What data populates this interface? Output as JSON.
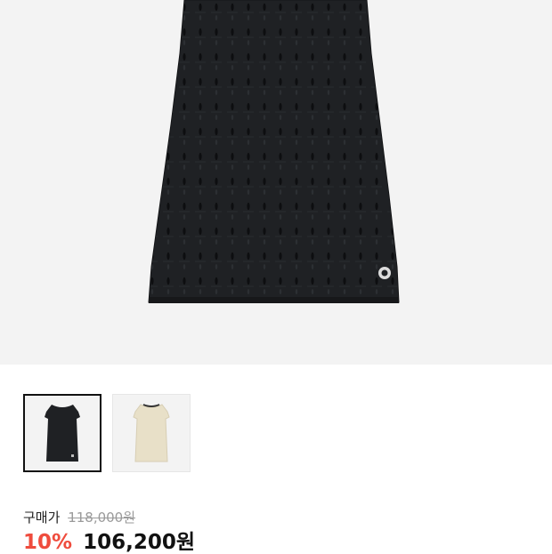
{
  "product": {
    "main_image": {
      "name": "product-image-black-knit-dress",
      "icon": "dress-image",
      "color": "#1f2124",
      "background": "#f3f3f3"
    },
    "thumbnails": [
      {
        "color": "#1f2124",
        "selected": true
      },
      {
        "color": "#e8e0c8",
        "selected": false
      }
    ],
    "price": {
      "label": "구매가",
      "original": "118,000원",
      "discount": "10%",
      "sale": "106,200원"
    },
    "accent_color": "#ef4c3d"
  }
}
